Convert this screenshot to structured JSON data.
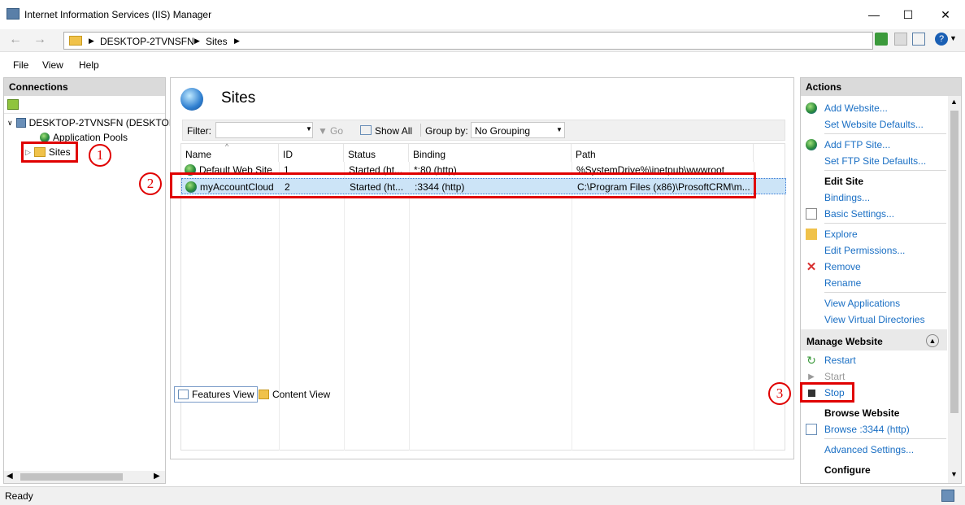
{
  "window": {
    "title": "Internet Information Services (IIS) Manager"
  },
  "address": {
    "crumbs": [
      "DESKTOP-2TVNSFN",
      "Sites"
    ]
  },
  "menu": [
    "File",
    "View",
    "Help"
  ],
  "connections": {
    "title": "Connections",
    "tree": {
      "server": "DESKTOP-2TVNSFN (DESKTOP",
      "app_pools": "Application Pools",
      "sites": "Sites"
    }
  },
  "center": {
    "title": "Sites",
    "filter_label": "Filter:",
    "filter_value": "",
    "go_label": "Go",
    "show_all_label": "Show All",
    "group_by_label": "Group by:",
    "group_by_value": "No Grouping",
    "columns": [
      "Name",
      "ID",
      "Status",
      "Binding",
      "Path"
    ],
    "rows": [
      {
        "name": "Default Web Site",
        "id": "1",
        "status": "Started (ht...",
        "binding": "*:80 (http)",
        "path": "%SystemDrive%\\inetpub\\wwwroot"
      },
      {
        "name": "myAccountCloud",
        "id": "2",
        "status": "Started (ht...",
        "binding": ":3344 (http)",
        "path": "C:\\Program Files (x86)\\ProsoftCRM\\m..."
      }
    ],
    "tab_features": "Features View",
    "tab_content": "Content View"
  },
  "actions": {
    "title": "Actions",
    "add_website": "Add Website...",
    "set_website_defaults": "Set Website Defaults...",
    "add_ftp_site": "Add FTP Site...",
    "set_ftp_defaults": "Set FTP Site Defaults...",
    "edit_site_heading": "Edit Site",
    "bindings": "Bindings...",
    "basic_settings": "Basic Settings...",
    "explore": "Explore",
    "edit_permissions": "Edit Permissions...",
    "remove": "Remove",
    "rename": "Rename",
    "view_applications": "View Applications",
    "view_virtual_directories": "View Virtual Directories",
    "manage_website_heading": "Manage Website",
    "restart": "Restart",
    "start": "Start",
    "stop": "Stop",
    "browse_heading": "Browse Website",
    "browse": "Browse :3344 (http)",
    "advanced_settings": "Advanced Settings...",
    "configure_heading": "Configure"
  },
  "status": {
    "text": "Ready"
  },
  "annotations": {
    "one": "1",
    "two": "2",
    "three": "3"
  },
  "colors": {
    "link": "#1a6fc4",
    "annotation": "#e00000",
    "panel_header": "#dadada"
  }
}
